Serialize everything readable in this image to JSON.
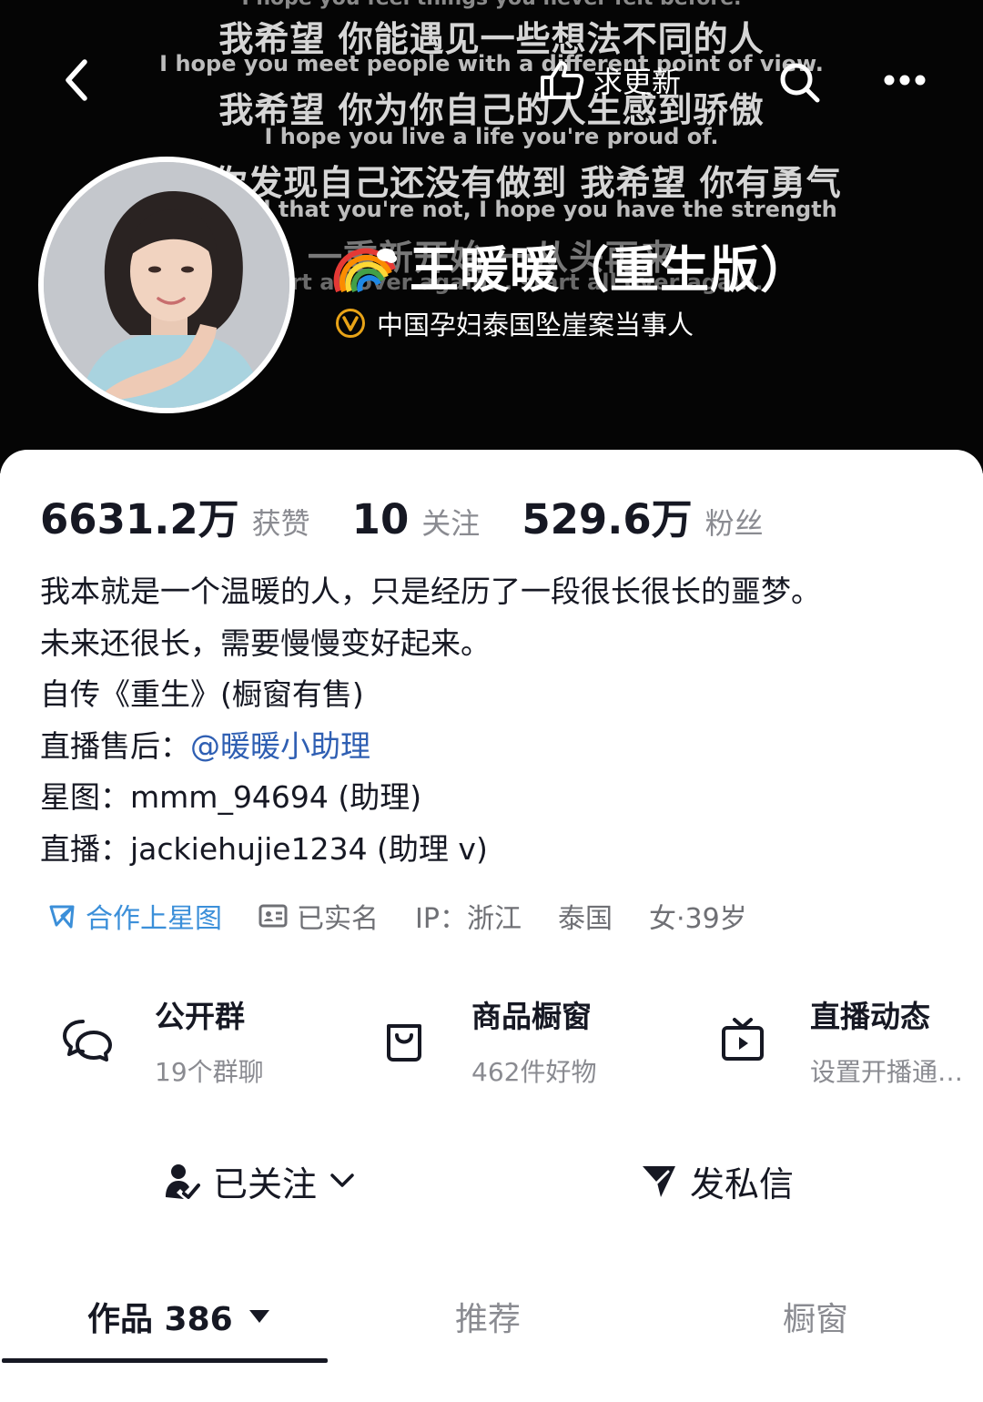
{
  "banner": {
    "bg_lines": [
      "I hope you feel things you never felt before.",
      "我希望 你能遇见一些想法不同的人",
      "I hope you meet people with a different point of view.",
      "我希望 你为你自己的人生感到骄傲",
      "I hope you live a life you're proud of.",
      "如果你发现自己还没有做到 我希望 你有勇气",
      "If you find that you're not, I hope you have the strength",
      "一重新开始 一从头再来",
      "to start all over again... start all over again."
    ]
  },
  "topbar": {
    "back_icon": "chevron-left-icon",
    "update_label": "求更新",
    "search_icon": "search-icon",
    "more_icon": "more-dots-icon"
  },
  "profile": {
    "name": "王暖暖（重生版）",
    "name_emoji_icon": "rainbow-icon",
    "verify_icon": "verified-v-icon",
    "verify_text": "中国孕妇泰国坠崖案当事人"
  },
  "stats": [
    {
      "value": "6631.2万",
      "label": "获赞"
    },
    {
      "value": "10",
      "label": "关注"
    },
    {
      "value": "529.6万",
      "label": "粉丝"
    }
  ],
  "bio": {
    "line1": "我本就是一个温暖的人，只是经历了一段很长很长的噩梦。",
    "line2": "未来还很长，需要慢慢变好起来。",
    "line3": "自传《重生》(橱窗有售)",
    "line4_prefix": "直播售后：",
    "line4_mention": "@暖暖小助理",
    "line5": "星图：mmm_94694 (助理)",
    "line6": "直播：jackiehujie1234 (助理 v)"
  },
  "tags": {
    "star": "合作上星图",
    "realname": "已实名",
    "ip": "IP：浙江",
    "location": "泰国",
    "gender_age": "女·39岁"
  },
  "entries": [
    {
      "title": "公开群",
      "sub": "19个群聊",
      "icon": "chat-bubbles-icon"
    },
    {
      "title": "商品橱窗",
      "sub": "462件好物",
      "icon": "shopping-bag-icon"
    },
    {
      "title": "直播动态",
      "sub": "设置开播通…",
      "icon": "tv-play-icon"
    }
  ],
  "actions": {
    "follow": "已关注",
    "message": "发私信"
  },
  "tabs": {
    "works": "作品 386",
    "recommend": "推荐",
    "showcase": "橱窗"
  },
  "colors": {
    "accent_blue": "#2f5fb3",
    "star_blue": "#3b8fd9",
    "verify_gold": "#e8a317",
    "text_primary": "#161823",
    "text_secondary": "#8a8b91"
  }
}
